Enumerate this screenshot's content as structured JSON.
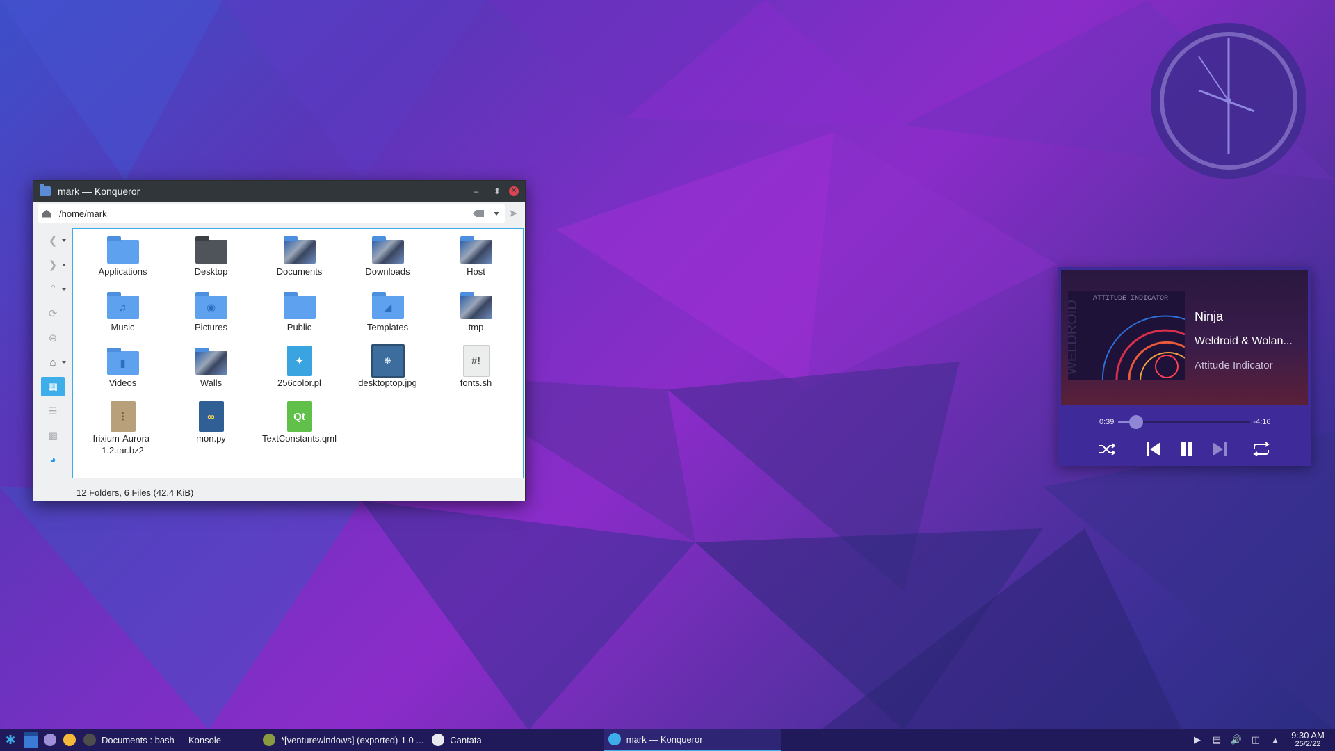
{
  "konqueror": {
    "title": "mark — Konqueror",
    "location": "/home/mark",
    "items": [
      {
        "label": "Applications",
        "kind": "folder"
      },
      {
        "label": "Desktop",
        "kind": "folder-dark"
      },
      {
        "label": "Documents",
        "kind": "folder-pic"
      },
      {
        "label": "Downloads",
        "kind": "folder-pic"
      },
      {
        "label": "Host",
        "kind": "folder-pic"
      },
      {
        "label": "Music",
        "kind": "folder-music"
      },
      {
        "label": "Pictures",
        "kind": "folder-camera"
      },
      {
        "label": "Public",
        "kind": "folder"
      },
      {
        "label": "Templates",
        "kind": "folder-templates"
      },
      {
        "label": "tmp",
        "kind": "folder-pic"
      },
      {
        "label": "Videos",
        "kind": "folder-video"
      },
      {
        "label": "Walls",
        "kind": "folder-pic"
      },
      {
        "label": "256color.pl",
        "kind": "perl-file"
      },
      {
        "label": "desktoptop.jpg",
        "kind": "image-thumb"
      },
      {
        "label": "fonts.sh",
        "kind": "shell-file"
      },
      {
        "label": "Irixium-Aurora-1.2.tar.bz2",
        "kind": "archive-file"
      },
      {
        "label": "mon.py",
        "kind": "python-file"
      },
      {
        "label": "TextConstants.qml",
        "kind": "qml-file"
      }
    ],
    "status": "12 Folders, 6 Files (42.4 KiB)"
  },
  "player": {
    "track": "Ninja",
    "artist": "Weldroid & Wolan...",
    "album": "Attitude Indicator",
    "elapsed": "0:39",
    "remaining": "-4:16",
    "progress_fraction": 0.133,
    "album_art_text": "ATTITUDE INDICATOR",
    "album_art_side": "WELDROID"
  },
  "taskbar": {
    "tasks": [
      {
        "label": "Documents : bash — Konsole",
        "icon": "terminal-icon"
      },
      {
        "label": "*[venturewindows] (exported)-1.0 ...",
        "icon": "gimp-icon"
      },
      {
        "label": "Cantata",
        "icon": "music-note-icon"
      },
      {
        "label": "mark — Konqueror",
        "icon": "konqueror-icon",
        "active": true
      }
    ],
    "time": "9:30 AM",
    "date": "25/2/22"
  },
  "colors": {
    "accent": "#3daee9",
    "titlebar": "#31363b",
    "close": "#da4453",
    "player_bg": "#3f2a9a",
    "taskbar": "#201a5a"
  }
}
